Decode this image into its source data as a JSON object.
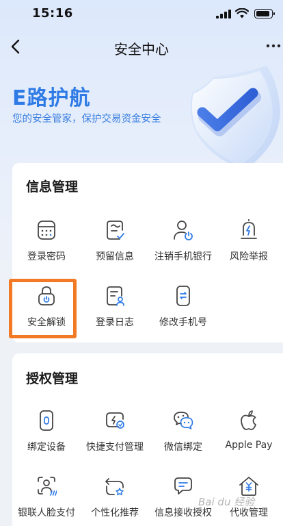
{
  "status": {
    "time": "15:16"
  },
  "nav": {
    "title": "安全中心"
  },
  "hero": {
    "title": "E路护航",
    "subtitle": "您的安全管家，保护交易资金安全"
  },
  "info_section": {
    "title": "信息管理",
    "items": [
      {
        "label": "登录密码",
        "icon": "password-keypad-icon"
      },
      {
        "label": "预留信息",
        "icon": "reserved-info-icon"
      },
      {
        "label": "注销手机银行",
        "icon": "user-power-icon"
      },
      {
        "label": "风险举报",
        "icon": "risk-report-icon"
      },
      {
        "label": "安全解锁",
        "icon": "unlock-icon"
      },
      {
        "label": "登录日志",
        "icon": "login-log-icon"
      },
      {
        "label": "修改手机号",
        "icon": "phone-change-icon"
      }
    ]
  },
  "auth_section": {
    "title": "授权管理",
    "items": [
      {
        "label": "绑定设备",
        "icon": "device-bind-icon"
      },
      {
        "label": "快捷支付管理",
        "icon": "quick-pay-icon"
      },
      {
        "label": "微信绑定",
        "icon": "wechat-icon"
      },
      {
        "label": "Apple Pay",
        "icon": "apple-icon"
      },
      {
        "label": "银联人脸支付",
        "icon": "face-pay-icon"
      },
      {
        "label": "个性化推荐",
        "icon": "personalized-icon"
      },
      {
        "label": "信息接收授权",
        "icon": "message-auth-icon"
      },
      {
        "label": "代收管理",
        "icon": "collection-house-icon"
      }
    ]
  },
  "watermark": "Bai du 经验",
  "colors": {
    "accent": "#2f7be6",
    "highlight": "#f27a25",
    "icon_stroke": "#444444"
  }
}
